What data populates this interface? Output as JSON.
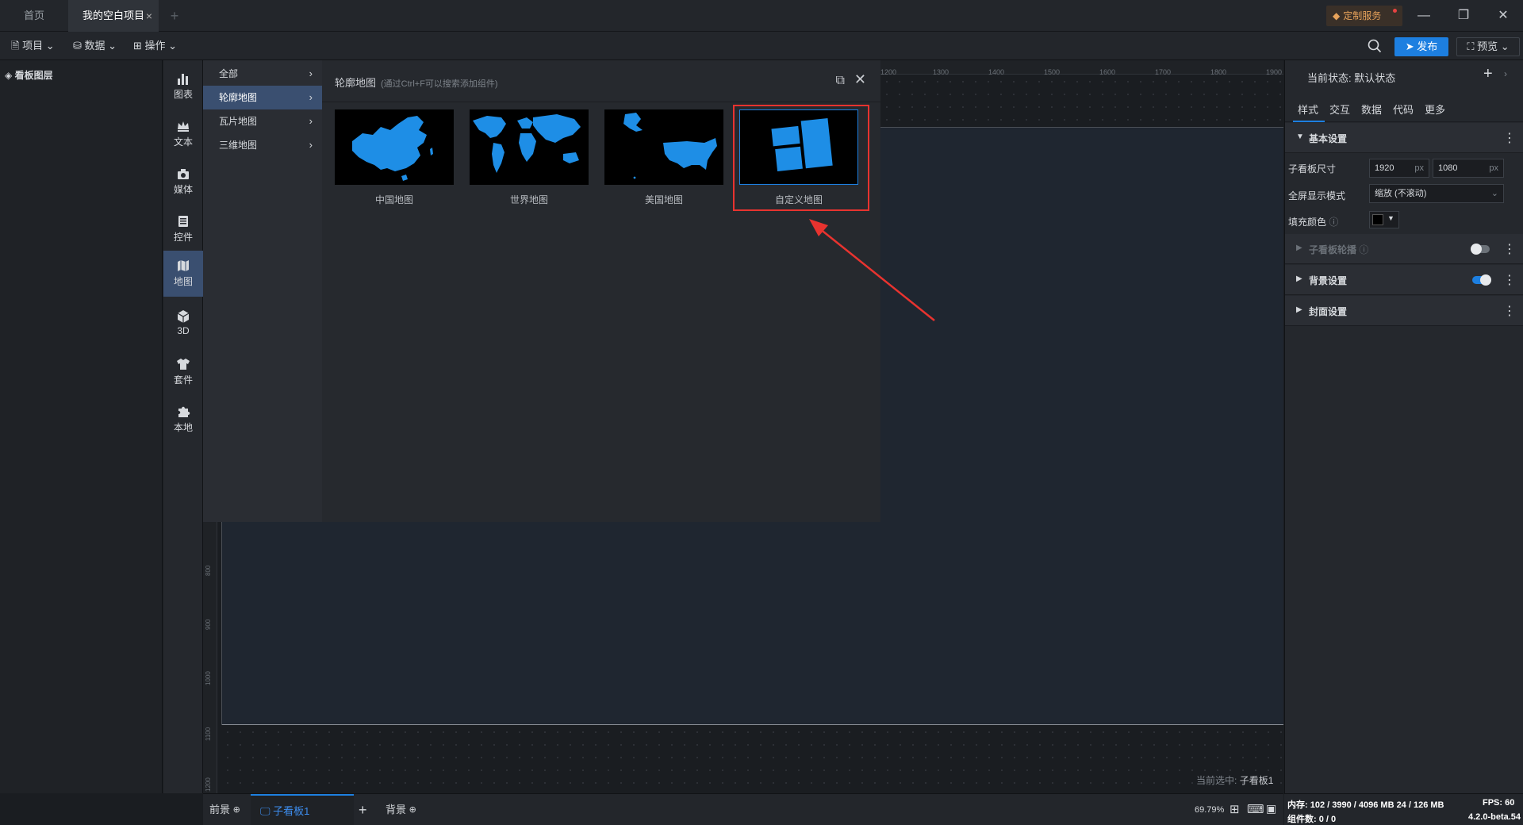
{
  "titlebar": {
    "tabs": [
      {
        "label": "首页"
      },
      {
        "label": "我的空白项目"
      }
    ],
    "tab_close": "×",
    "tab_add": "+",
    "service_button": "定制服务"
  },
  "toolbar": {
    "menus": [
      {
        "label": "项目"
      },
      {
        "label": "数据"
      },
      {
        "label": "操作"
      }
    ],
    "publish": "发布",
    "preview": "预览"
  },
  "layers": {
    "title": "看板图层"
  },
  "component_bar": [
    {
      "label": "图表",
      "icon": "bar-chart-icon"
    },
    {
      "label": "文本",
      "icon": "crown-text-icon"
    },
    {
      "label": "媒体",
      "icon": "media-icon"
    },
    {
      "label": "控件",
      "icon": "control-icon"
    },
    {
      "label": "地图",
      "icon": "map-icon",
      "active": true
    },
    {
      "label": "3D",
      "icon": "cube-icon"
    },
    {
      "label": "套件",
      "icon": "shirt-icon"
    },
    {
      "label": "本地",
      "icon": "puzzle-icon"
    }
  ],
  "categories": [
    {
      "label": "全部"
    },
    {
      "label": "轮廓地图",
      "active": true
    },
    {
      "label": "瓦片地图"
    },
    {
      "label": "三维地图"
    }
  ],
  "map_panel": {
    "title": "轮廓地图",
    "hint": "(通过Ctrl+F可以搜索添加组件)",
    "items": [
      {
        "label": "中国地图"
      },
      {
        "label": "世界地图"
      },
      {
        "label": "美国地图"
      },
      {
        "label": "自定义地图",
        "selected": true
      }
    ]
  },
  "ruler": {
    "top_ticks": [
      "1200",
      "1300",
      "1400",
      "1500",
      "1600",
      "1700",
      "1800",
      "1900"
    ],
    "left_ticks": [
      "800",
      "900",
      "1000",
      "1100",
      "1200"
    ]
  },
  "canvas": {
    "selection_label": "当前选中:",
    "selection_value": "子看板1"
  },
  "right_panel": {
    "state_label": "当前状态:",
    "state_value": "默认状态",
    "tabs": [
      {
        "label": "样式"
      },
      {
        "label": "交互"
      },
      {
        "label": "数据"
      },
      {
        "label": "代码"
      },
      {
        "label": "更多"
      }
    ],
    "basic_section": "基本设置",
    "size_label": "子看板尺寸",
    "width_value": "1920",
    "height_value": "1080",
    "unit": "px",
    "fullscreen_label": "全屏显示模式",
    "fullscreen_value": "缩放 (不滚动)",
    "fill_label": "填充颜色",
    "fill_color": "#000000",
    "carousel_section": "子看板轮播",
    "background_section": "背景设置",
    "cover_section": "封面设置"
  },
  "bottom": {
    "foreground": "前景",
    "board_tab": "子看板1",
    "background": "背景",
    "zoom": "69.79%"
  },
  "status": {
    "memory": "内存: 102 / 3990 / 4096 MB  24 / 126 MB",
    "fps_label": "FPS:",
    "fps_value": "60",
    "components": "组件数: 0 / 0",
    "version": "4.2.0-beta.54"
  },
  "colors": {
    "accent": "#1d7fe0",
    "highlight": "#e8332f",
    "map_fill": "#1e8ee6"
  }
}
